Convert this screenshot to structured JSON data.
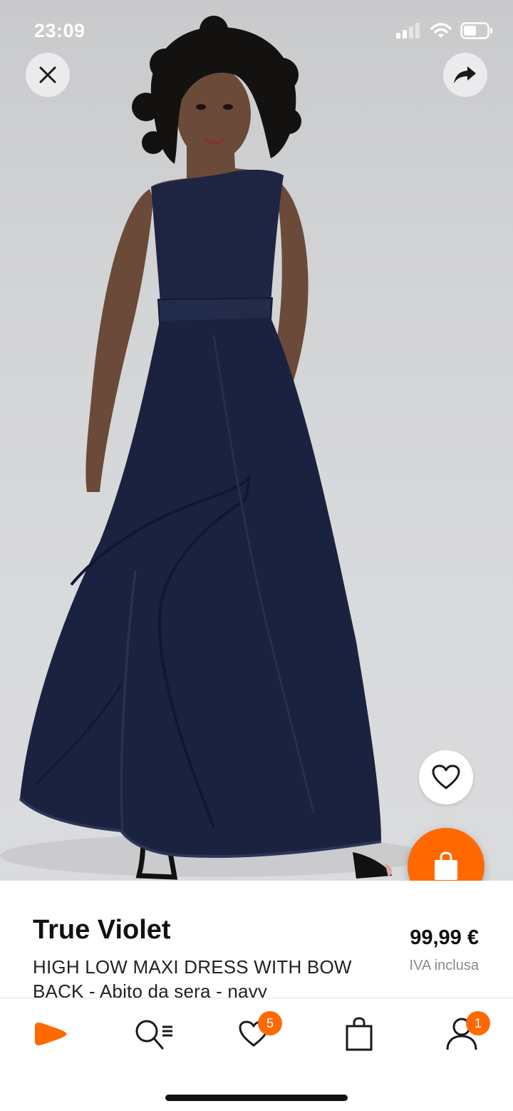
{
  "status_bar": {
    "time": "23:09"
  },
  "product": {
    "brand": "True Violet",
    "description": "HIGH LOW MAXI DRESS WITH BOW BACK - Abito da sera - navy",
    "price": "99,99 €",
    "vat_note": "IVA inclusa",
    "image_icon": "navy-dress-photo"
  },
  "actions": {
    "close_icon": "close-icon",
    "share_icon": "share-icon",
    "wishlist_icon": "heart-icon",
    "add_to_cart_icon": "shopping-bag-icon"
  },
  "tabbar": {
    "items": [
      {
        "id": "home",
        "icon": "zalando-logo-icon"
      },
      {
        "id": "search",
        "icon": "search-list-icon"
      },
      {
        "id": "wishlist",
        "icon": "heart-icon",
        "badge": "5"
      },
      {
        "id": "bag",
        "icon": "shopping-bag-icon"
      },
      {
        "id": "account",
        "icon": "user-icon",
        "badge": "1"
      }
    ]
  },
  "colors": {
    "accent": "#ff6900",
    "dress": "#1c2340",
    "background": "#d6d7d9"
  }
}
